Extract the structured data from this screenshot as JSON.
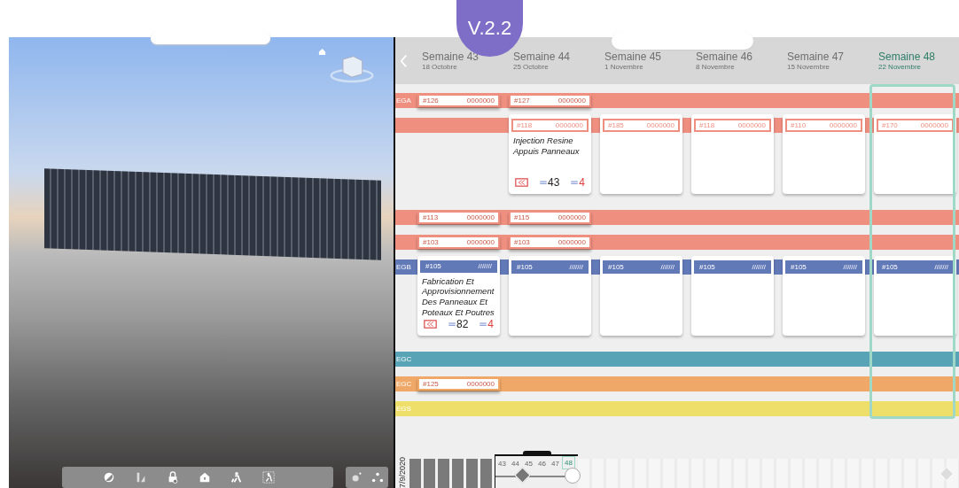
{
  "version_badge": "V.2.2",
  "weeks": [
    {
      "title": "Semaine 43",
      "date": "18 Octobre",
      "selected": false
    },
    {
      "title": "Semaine 44",
      "date": "25 Octobre",
      "selected": false
    },
    {
      "title": "Semaine 45",
      "date": "1 Novembre",
      "selected": false
    },
    {
      "title": "Semaine 46",
      "date": "8 Novembre",
      "selected": false
    },
    {
      "title": "Semaine 47",
      "date": "15 Novembre",
      "selected": false
    },
    {
      "title": "Semaine 48",
      "date": "22 Novembre",
      "selected": true
    }
  ],
  "lanes": [
    {
      "label": "EGA",
      "color": "#ee8f80",
      "cells": [
        {
          "kind": "chip",
          "id": "#126",
          "code": "0000000"
        },
        {
          "kind": "chip",
          "id": "#127",
          "code": "0000000"
        },
        {
          "kind": "empty"
        },
        {
          "kind": "empty"
        },
        {
          "kind": "empty"
        },
        {
          "kind": "empty"
        }
      ]
    },
    {
      "color": "#ee8f80",
      "cells": [
        {
          "kind": "empty"
        },
        {
          "kind": "card",
          "id": "#118",
          "code": "0000000",
          "title": "Injection Resine Appuis Panneaux",
          "count_a": "43",
          "count_b": "4"
        },
        {
          "kind": "card",
          "id": "#185",
          "code": "0000000"
        },
        {
          "kind": "card",
          "id": "#118",
          "code": "0000000"
        },
        {
          "kind": "card",
          "id": "#110",
          "code": "0000000"
        },
        {
          "kind": "card",
          "id": "#170",
          "code": "0000000"
        }
      ]
    },
    {
      "color": "#ee8f80",
      "cells": [
        {
          "kind": "chip",
          "id": "#113",
          "code": "0000000"
        },
        {
          "kind": "chip",
          "id": "#115",
          "code": "0000000"
        },
        {
          "kind": "empty"
        },
        {
          "kind": "empty"
        },
        {
          "kind": "empty"
        },
        {
          "kind": "empty"
        }
      ]
    },
    {
      "color": "#ee8f80",
      "cells": [
        {
          "kind": "chip",
          "id": "#103",
          "code": "0000000"
        },
        {
          "kind": "chip",
          "id": "#103",
          "code": "0000000"
        },
        {
          "kind": "empty"
        },
        {
          "kind": "empty"
        },
        {
          "kind": "empty"
        },
        {
          "kind": "empty"
        }
      ]
    },
    {
      "label": "EGB",
      "color": "#6279b8",
      "cells": [
        {
          "kind": "card",
          "id": "#105",
          "code": "///////",
          "title": "Fabrication Et Approvisionnement Des Panneaux Et Poteaux Et Poutres",
          "count_a": "82",
          "count_b": "4"
        },
        {
          "kind": "card",
          "id": "#105",
          "code": "///////"
        },
        {
          "kind": "card",
          "id": "#105",
          "code": "///////"
        },
        {
          "kind": "card",
          "id": "#105",
          "code": "///////"
        },
        {
          "kind": "card",
          "id": "#105",
          "code": "///////"
        },
        {
          "kind": "card",
          "id": "#105",
          "code": "///////"
        }
      ]
    },
    {
      "label": "EGC",
      "color": "#58a3b5"
    },
    {
      "label": "EGC",
      "color": "#f0a868",
      "cells": [
        {
          "kind": "chip",
          "id": "#125",
          "code": "0000000"
        }
      ]
    },
    {
      "label": "EGS",
      "color": "#eedf6a"
    }
  ],
  "timeline": {
    "date": "7/9/2020",
    "weeks": [
      {
        "label": "43",
        "selected": false
      },
      {
        "label": "44",
        "selected": false
      },
      {
        "label": "45",
        "selected": false
      },
      {
        "label": "46",
        "selected": false
      },
      {
        "label": "47",
        "selected": false
      },
      {
        "label": "48",
        "selected": true
      }
    ]
  }
}
